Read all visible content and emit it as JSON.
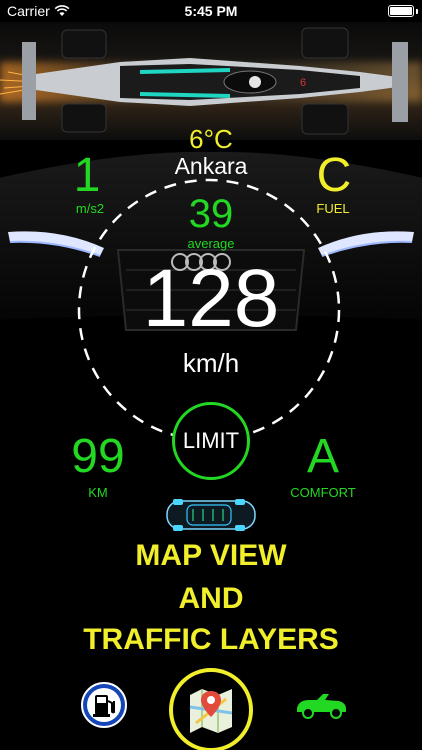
{
  "status_bar": {
    "carrier": "Carrier",
    "time": "5:45 PM"
  },
  "weather": {
    "temperature": "6°C",
    "city": "Ankara"
  },
  "acceleration": {
    "value": "1",
    "unit": "m/s2"
  },
  "fuel": {
    "value": "C",
    "label": "FUEL"
  },
  "average": {
    "value": "39",
    "label": "average"
  },
  "speed": {
    "value": "128",
    "unit": "km/h"
  },
  "limit_button": {
    "label": "LIMIT"
  },
  "distance": {
    "value": "99",
    "unit": "KM"
  },
  "comfort": {
    "value": "A",
    "label": "COMFORT"
  },
  "promo": {
    "line1": "MAP VIEW",
    "line2": "AND",
    "line3": "TRAFFIC LAYERS"
  },
  "colors": {
    "green": "#22d822",
    "yellow": "#f1ee2b",
    "background": "#000000"
  },
  "icons": {
    "fuel_button": "gas-pump-icon",
    "map_button": "map-pin-icon",
    "car_button": "convertible-car-icon"
  }
}
